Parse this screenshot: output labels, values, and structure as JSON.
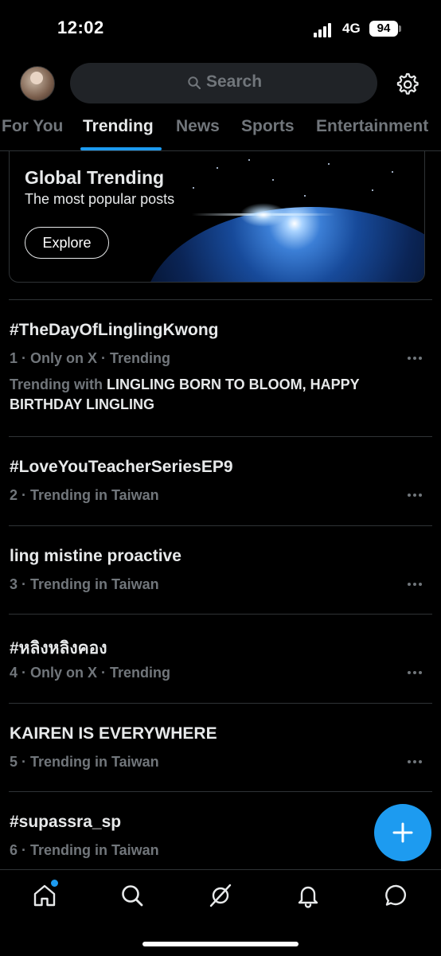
{
  "status_bar": {
    "time": "12:02",
    "network": "4G",
    "battery": "94"
  },
  "header": {
    "search_placeholder": "Search"
  },
  "tabs": [
    {
      "label": "For You"
    },
    {
      "label": "Trending"
    },
    {
      "label": "News"
    },
    {
      "label": "Sports"
    },
    {
      "label": "Entertainment"
    }
  ],
  "active_tab": "Trending",
  "global_card": {
    "title": "Global Trending",
    "subtitle": "The most popular posts",
    "button": "Explore"
  },
  "trends": [
    {
      "title": "#TheDayOfLinglingKwong",
      "meta": "1 · Only on X · Trending",
      "with_prefix": "Trending with ",
      "with_topics": "LINGLING BORN TO BLOOM, HAPPY BIRTHDAY LINGLING"
    },
    {
      "title": "#LoveYouTeacherSeriesEP9",
      "meta": "2 · Trending in Taiwan"
    },
    {
      "title": "ling mistine proactive",
      "meta": "3 · Trending in Taiwan"
    },
    {
      "title": "#หลิงหลิงคอง",
      "meta": "4 · Only on X · Trending"
    },
    {
      "title": "KAIREN IS EVERYWHERE",
      "meta": "5 · Trending in Taiwan"
    },
    {
      "title": "#supassra_sp",
      "meta": "6 · Trending in Taiwan"
    }
  ],
  "colors": {
    "accent": "#1d9bf0",
    "background": "#000000",
    "muted": "#71767b",
    "text": "#e7e9ea"
  },
  "bottom_nav": [
    {
      "icon": "home-icon"
    },
    {
      "icon": "search-icon"
    },
    {
      "icon": "grok-icon"
    },
    {
      "icon": "bell-icon"
    },
    {
      "icon": "messages-icon"
    }
  ]
}
